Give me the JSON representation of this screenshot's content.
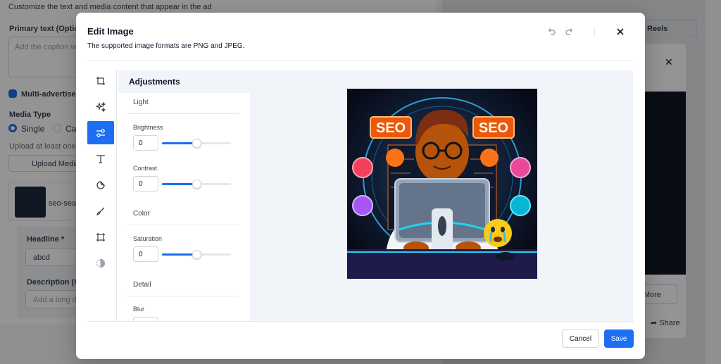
{
  "background": {
    "intro": "Customize the text and media content that appear in the ad",
    "primary_text_label": "Primary text (Optiona",
    "caption_placeholder": "Add the caption wh",
    "multi_advertiser_label": "Multi-advertiser a",
    "media_type_label": "Media Type",
    "media_single": "Single",
    "media_carousel": "Ca",
    "upload_hint": "Upload at least one m",
    "upload_button": "Upload Media",
    "file_name": "seo-sear",
    "headline_label": "Headline *",
    "headline_value": "abcd",
    "description_label": "Description (Op",
    "description_placeholder": "Add a long de",
    "reels_tab": "Reels",
    "learn_more": "rn More",
    "share": "Share"
  },
  "modal": {
    "title": "Edit Image",
    "subtitle": "The supported image formats are PNG and JPEG."
  },
  "toolbar": {
    "tools": [
      "crop-icon",
      "sparkles-icon",
      "adjustments-icon",
      "text-icon",
      "sticker-icon",
      "brush-icon",
      "frame-icon",
      "contrast-icon"
    ],
    "active_index": 2
  },
  "panel": {
    "title": "Adjustments",
    "sections": {
      "light": "Light",
      "color": "Color",
      "detail": "Detail"
    },
    "controls": {
      "brightness": {
        "label": "Brightness",
        "value": "0",
        "level": 0.5
      },
      "contrast": {
        "label": "Contrast",
        "value": "0",
        "level": 0.5
      },
      "saturation": {
        "label": "Saturation",
        "value": "0",
        "level": 0.5
      },
      "blur": {
        "label": "Blur",
        "value": ""
      }
    }
  },
  "image": {
    "badge_left": "SEO",
    "badge_right": "SEO"
  },
  "footer": {
    "cancel": "Cancel",
    "save": "Save"
  }
}
